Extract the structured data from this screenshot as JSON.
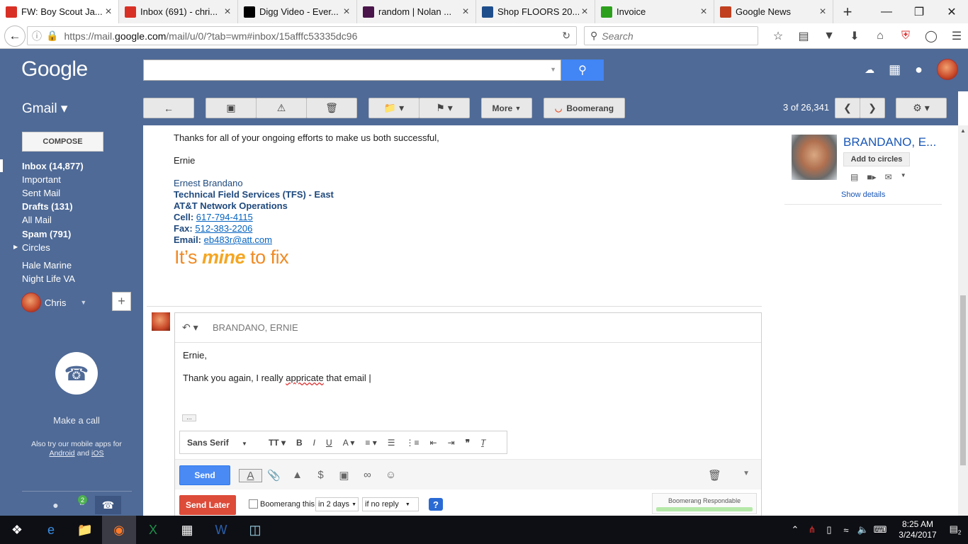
{
  "browser": {
    "tabs": [
      {
        "title": "FW: Boy Scout Ja...",
        "icon": "gmail-icon",
        "color": "#d93025",
        "active": true
      },
      {
        "title": "Inbox (691) - chri...",
        "icon": "gmail-icon",
        "color": "#d93025"
      },
      {
        "title": "Digg Video - Ever...",
        "icon": "digg-icon",
        "color": "#000000"
      },
      {
        "title": "random | Nolan ...",
        "icon": "slack-icon",
        "color": "#4a154b"
      },
      {
        "title": "Shop FLOORS 20...",
        "icon": "store-icon",
        "color": "#1f4e8c"
      },
      {
        "title": "Invoice",
        "icon": "quickbooks-icon",
        "color": "#2ca01c"
      },
      {
        "title": "Google News",
        "icon": "news-icon",
        "color": "#c04020"
      }
    ],
    "url_prefix": "https://mail.",
    "url_host": "google.com",
    "url_path": "/mail/u/0/?tab=wm#inbox/15afffc53335dc96",
    "search_placeholder": "Search"
  },
  "gmail": {
    "logo": "Google",
    "app_label": "Gmail ▾",
    "toolbar": {
      "more_label": "More",
      "boomerang_label": "Boomerang",
      "page_count": "3 of 26,341"
    },
    "compose_label": "COMPOSE",
    "nav": [
      {
        "label": "Inbox (14,877)",
        "bold": true
      },
      {
        "label": "Important",
        "bold": false
      },
      {
        "label": "Sent Mail",
        "bold": false
      },
      {
        "label": "Drafts (131)",
        "bold": true
      },
      {
        "label": "All Mail",
        "bold": false
      },
      {
        "label": "Spam (791)",
        "bold": true
      },
      {
        "label": "Circles",
        "bold": false
      },
      {
        "label": "Hale Marine",
        "bold": false
      },
      {
        "label": "Night Life VA",
        "bold": false
      }
    ],
    "account_name": "Chris",
    "hangouts": {
      "make_call": "Make a call",
      "also_try": "Also try our mobile apps for",
      "android": "Android",
      "and": "and",
      "ios": "iOS",
      "badge": "2"
    }
  },
  "email": {
    "thanks_line": "Thanks for all of your ongoing efforts to make us both successful,",
    "signoff": "Ernie",
    "sig_name": "Ernest Brandano",
    "sig_title": "Technical Field Services (TFS) -  East",
    "sig_org": "AT&T Network Operations",
    "cell_label": "Cell:",
    "cell": "617-794-4115",
    "fax_label": "Fax:",
    "fax": "512-383-2206",
    "email_label": "Email:",
    "email": "eb483r@att.com",
    "logo_pre": "It’s",
    "logo_mid": "mine",
    "logo_post": "to fix"
  },
  "reply": {
    "to": "BRANDANO, ERNIE",
    "line1": "Ernie,",
    "line2_pre": "Thank you again, I really",
    "line2_misspelled": "appricate",
    "line2_post": "that email",
    "font_name": "Sans Serif",
    "send_label": "Send",
    "send_later_label": "Send Later",
    "boomerang_this": "Boomerang this",
    "delay": "in 2 days",
    "condition": "if no reply",
    "respondable": "Boomerang Respondable"
  },
  "contact": {
    "name": "BRANDANO, E...",
    "add_circles": "Add to circles",
    "show_details": "Show details"
  },
  "taskbar": {
    "time": "8:25 AM",
    "date": "3/24/2017",
    "notif_count": "2"
  }
}
